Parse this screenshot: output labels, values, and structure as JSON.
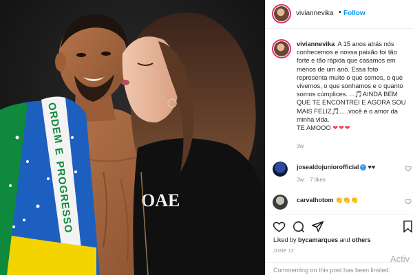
{
  "post": {
    "image_alt": "",
    "flag_text": [
      "ORDEM",
      "E",
      "PROGRESSO"
    ],
    "shirt_text": "OAE"
  },
  "header": {
    "username": "viviannevika",
    "separator": "•",
    "follow_label": "Follow"
  },
  "caption": {
    "username": "viviannevika",
    "text_part1": "A 15 anos atrás nós conhecemos e nossa paixão foi tão forte e tão rápida que casamos em menos de um ano. Essa foto representa muito o que somos, o que vivemos, o que sonhamos e o quanto somos cúmplices. ...",
    "music1": "🎵",
    "text_part2": "AINDA BEM QUE TE ENCONTREI E AGORA SOU MAIS FELIZ",
    "music2": "🎵",
    "text_part3": ".....você é o amor da minha vida.",
    "text_part4": "TE AMOOO",
    "hearts": "❤❤❤",
    "age": "3w"
  },
  "comments": [
    {
      "username": "josealdojuniorofficial",
      "verified": true,
      "text": "♥♥",
      "age": "3w",
      "likes": "7 likes"
    },
    {
      "username": "carvalhotom",
      "verified": false,
      "text": "👏👏👏",
      "age": "",
      "likes": ""
    }
  ],
  "actions": {
    "liked_prefix": "Liked by",
    "liked_user": "bycamarques",
    "liked_and": "and",
    "liked_others": "others",
    "date": "JUNE 12",
    "comments_limited": "Commenting on this post has been limited."
  },
  "overlay": {
    "watermark": "Activ"
  },
  "colors": {
    "accent": "#0095f6",
    "heart": "#ed4956",
    "story_ring": "#e1306c"
  }
}
